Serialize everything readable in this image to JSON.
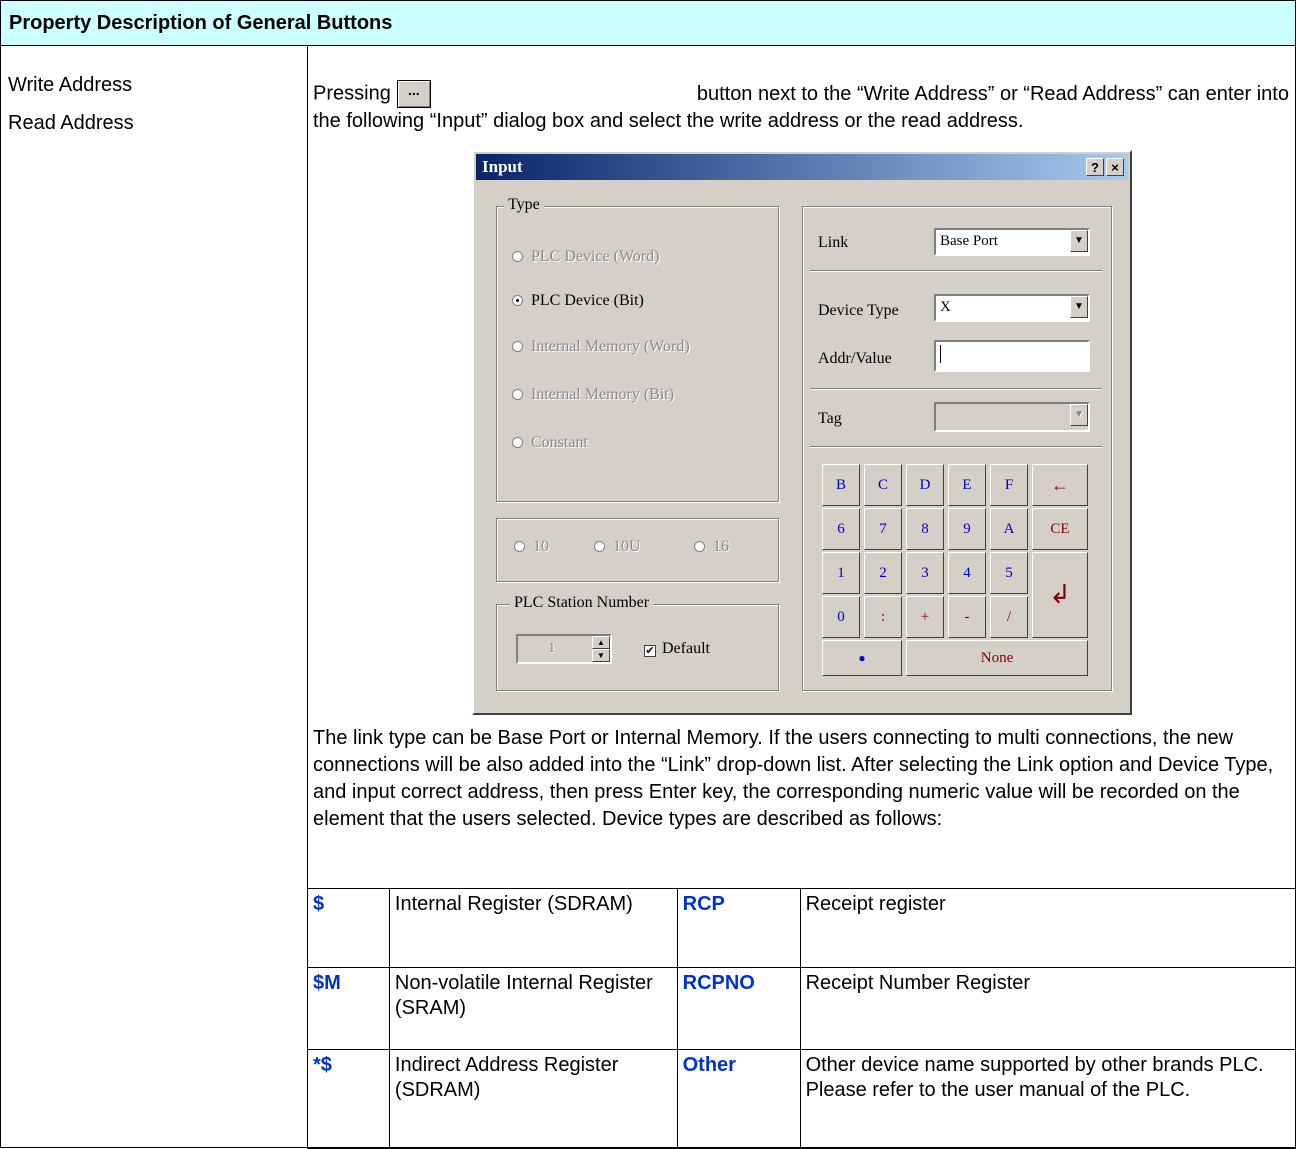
{
  "header": {
    "title": "Property Description of General Buttons"
  },
  "left": {
    "labels": [
      "Write Address",
      "Read Address"
    ]
  },
  "intro": {
    "before_button": "Pressing",
    "button_glyph": "...",
    "after_button": "button next to the “Write Address” or “Read Address” can enter into",
    "line2": "the following “Input” dialog box and select the write address or the read address."
  },
  "dialog": {
    "title": "Input",
    "help_button": "?",
    "close_button": "×",
    "type_group": {
      "label": "Type",
      "options": [
        "PLC Device (Word)",
        "PLC Device (Bit)",
        "Internal Memory (Word)",
        "Internal Memory (Bit)",
        "Constant"
      ],
      "selected": "PLC Device (Bit)"
    },
    "radix_options": [
      "10",
      "10U",
      "16"
    ],
    "station_group": {
      "label": "PLC Station Number",
      "value": "1",
      "default_label": "Default",
      "default_checked": true
    },
    "link": {
      "label": "Link",
      "value": "Base Port"
    },
    "device_type": {
      "label": "Device Type",
      "value": "X"
    },
    "addr_value": {
      "label": "Addr/Value",
      "value": ""
    },
    "tag": {
      "label": "Tag",
      "value": ""
    },
    "keypad": {
      "row1": [
        "B",
        "C",
        "D",
        "E",
        "F"
      ],
      "row2": [
        "6",
        "7",
        "8",
        "9",
        "A"
      ],
      "row3": [
        "1",
        "2",
        "3",
        "4",
        "5"
      ],
      "row4": [
        "0",
        ":",
        "+",
        "-",
        "/"
      ],
      "backspace": "←",
      "clear": "CE",
      "enter": "↲",
      "dot": "●",
      "none": "None"
    }
  },
  "description": "The link type can be Base Port or Internal Memory. If the users connecting to multi connections, the new connections will be also added into the “Link” drop-down list. After selecting the Link option and Device Type, and input correct address, then press Enter key, the corresponding numeric value will be recorded on the element that the users selected. Device types are described as follows:",
  "device_table": [
    {
      "code1": "$",
      "desc1": "Internal Register (SDRAM)",
      "code2": "RCP",
      "desc2": "Receipt register"
    },
    {
      "code1": "$M",
      "desc1": "Non-volatile Internal Register (SRAM)",
      "code2": "RCPNO",
      "desc2": "Receipt Number Register"
    },
    {
      "code1": "*$",
      "desc1": "Indirect Address Register (SDRAM)",
      "code2": "Other",
      "desc2": "Other device name supported by other brands PLC. Please refer to the user manual of the PLC."
    }
  ]
}
